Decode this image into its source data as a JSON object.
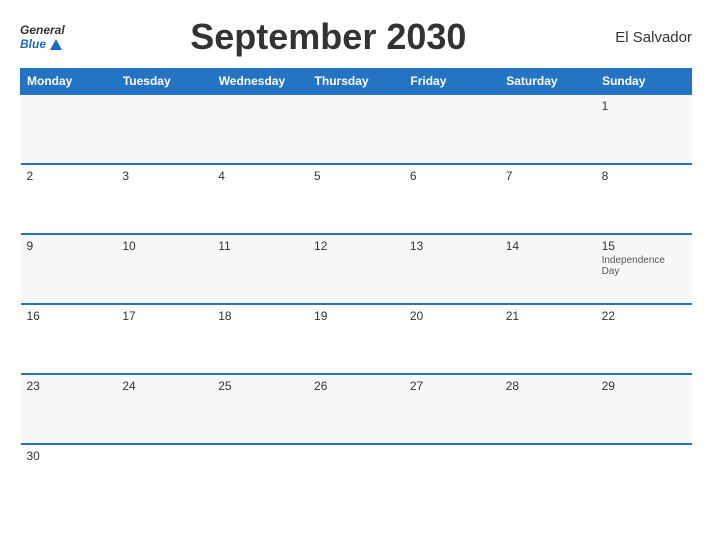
{
  "header": {
    "logo_line1": "General",
    "logo_line2": "Blue",
    "title": "September 2030",
    "country": "El Salvador"
  },
  "weekdays": [
    "Monday",
    "Tuesday",
    "Wednesday",
    "Thursday",
    "Friday",
    "Saturday",
    "Sunday"
  ],
  "weeks": [
    [
      {
        "day": "",
        "event": ""
      },
      {
        "day": "",
        "event": ""
      },
      {
        "day": "",
        "event": ""
      },
      {
        "day": "",
        "event": ""
      },
      {
        "day": "",
        "event": ""
      },
      {
        "day": "",
        "event": ""
      },
      {
        "day": "1",
        "event": ""
      }
    ],
    [
      {
        "day": "2",
        "event": ""
      },
      {
        "day": "3",
        "event": ""
      },
      {
        "day": "4",
        "event": ""
      },
      {
        "day": "5",
        "event": ""
      },
      {
        "day": "6",
        "event": ""
      },
      {
        "day": "7",
        "event": ""
      },
      {
        "day": "8",
        "event": ""
      }
    ],
    [
      {
        "day": "9",
        "event": ""
      },
      {
        "day": "10",
        "event": ""
      },
      {
        "day": "11",
        "event": ""
      },
      {
        "day": "12",
        "event": ""
      },
      {
        "day": "13",
        "event": ""
      },
      {
        "day": "14",
        "event": ""
      },
      {
        "day": "15",
        "event": "Independence Day"
      }
    ],
    [
      {
        "day": "16",
        "event": ""
      },
      {
        "day": "17",
        "event": ""
      },
      {
        "day": "18",
        "event": ""
      },
      {
        "day": "19",
        "event": ""
      },
      {
        "day": "20",
        "event": ""
      },
      {
        "day": "21",
        "event": ""
      },
      {
        "day": "22",
        "event": ""
      }
    ],
    [
      {
        "day": "23",
        "event": ""
      },
      {
        "day": "24",
        "event": ""
      },
      {
        "day": "25",
        "event": ""
      },
      {
        "day": "26",
        "event": ""
      },
      {
        "day": "27",
        "event": ""
      },
      {
        "day": "28",
        "event": ""
      },
      {
        "day": "29",
        "event": ""
      }
    ],
    [
      {
        "day": "30",
        "event": ""
      },
      {
        "day": "",
        "event": ""
      },
      {
        "day": "",
        "event": ""
      },
      {
        "day": "",
        "event": ""
      },
      {
        "day": "",
        "event": ""
      },
      {
        "day": "",
        "event": ""
      },
      {
        "day": "",
        "event": ""
      }
    ]
  ]
}
